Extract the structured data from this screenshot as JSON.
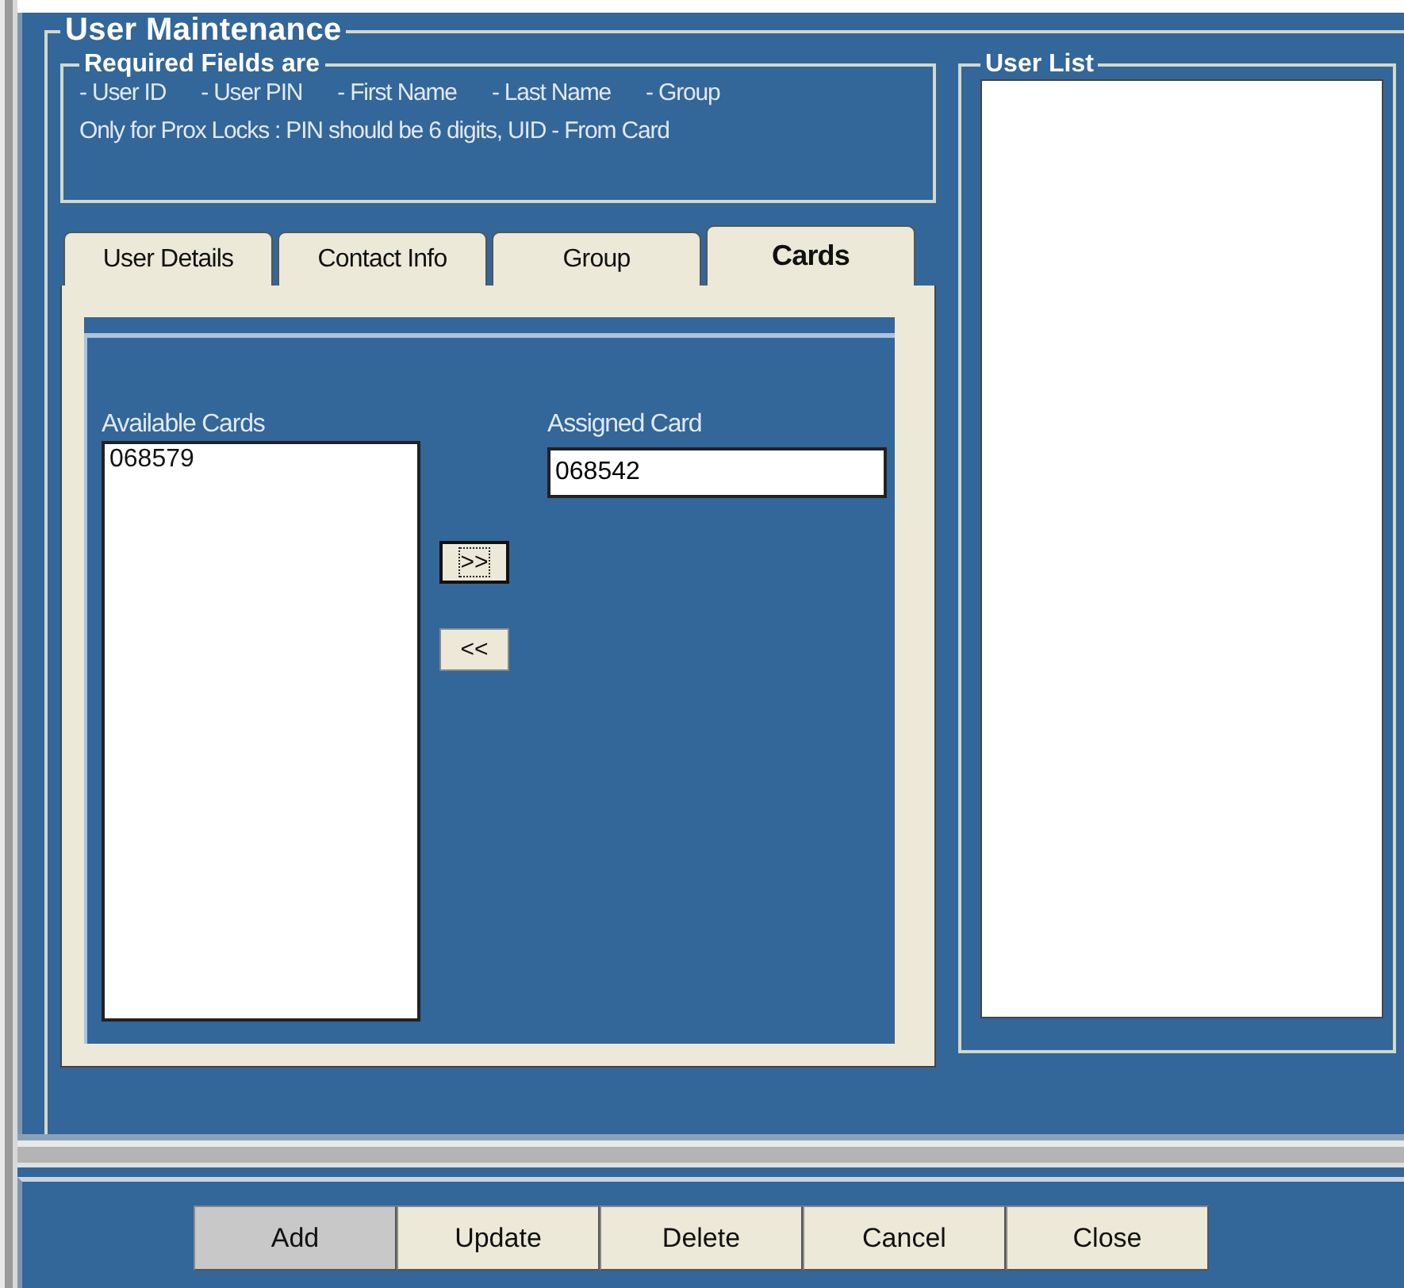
{
  "panel": {
    "title": "User Maintenance"
  },
  "required_fields": {
    "title": "Required Fields are",
    "fields": [
      "- User ID",
      "- User PIN",
      "- First Name",
      "- Last Name",
      "- Group"
    ],
    "note": "Only for Prox Locks : PIN should be 6 digits, UID - From Card"
  },
  "tabs": [
    {
      "label": "User Details",
      "selected": false
    },
    {
      "label": "Contact Info",
      "selected": false
    },
    {
      "label": "Group",
      "selected": false
    },
    {
      "label": "Cards",
      "selected": true
    }
  ],
  "cards": {
    "available_label": "Available Cards",
    "available": [
      "068579"
    ],
    "assigned_label": "Assigned Card",
    "assigned_value": "068542",
    "move_buttons": [
      {
        "label": ">>",
        "focused": true
      },
      {
        "label": "<<",
        "focused": false
      }
    ]
  },
  "user_list": {
    "title": "User List"
  },
  "buttons": [
    {
      "label": "Add",
      "pressed": true
    },
    {
      "label": "Update",
      "pressed": false
    },
    {
      "label": "Delete",
      "pressed": false
    },
    {
      "label": "Cancel",
      "pressed": false
    },
    {
      "label": "Close",
      "pressed": false
    }
  ]
}
